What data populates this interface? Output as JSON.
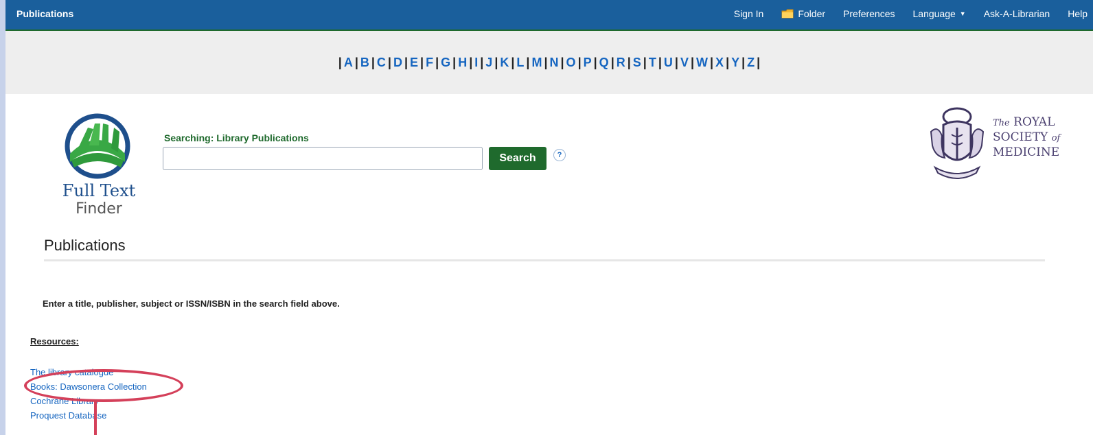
{
  "topbar": {
    "title": "Publications",
    "nav": {
      "sign_in": "Sign In",
      "folder": "Folder",
      "preferences": "Preferences",
      "language": "Language",
      "ask_librarian": "Ask-A-Librarian",
      "help": "Help"
    }
  },
  "alphabet": [
    "A",
    "B",
    "C",
    "D",
    "E",
    "F",
    "G",
    "H",
    "I",
    "J",
    "K",
    "L",
    "M",
    "N",
    "O",
    "P",
    "Q",
    "R",
    "S",
    "T",
    "U",
    "V",
    "W",
    "X",
    "Y",
    "Z"
  ],
  "logo": {
    "line1": "Full Text",
    "line2": "Finder"
  },
  "search": {
    "label": "Searching: Library Publications",
    "input_value": "",
    "button": "Search",
    "help": "?"
  },
  "rsm_logo": {
    "the": "The",
    "royal": "ROYAL",
    "society": "SOCIETY",
    "of": "of",
    "medicine": "MEDICINE"
  },
  "main": {
    "title": "Publications",
    "hint": "Enter a title, publisher, subject or ISSN/ISBN in the search field above.",
    "resources_heading": "Resources:",
    "resources": [
      "The library catalogue",
      "Books: Dawsonera Collection",
      "Cochrane Library",
      "Proquest Database"
    ]
  },
  "colors": {
    "topbar": "#1a5f9c",
    "accent_green": "#1f6a2d",
    "link": "#1565c0",
    "highlight": "#d4405a"
  }
}
